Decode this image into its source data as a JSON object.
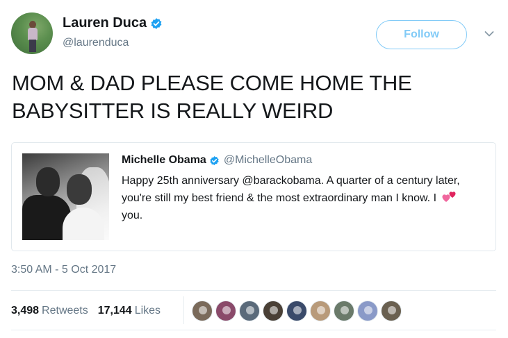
{
  "author": {
    "name": "Lauren Duca",
    "handle": "@laurenduca",
    "verified": true
  },
  "follow_label": "Follow",
  "tweet_text": "MOM & DAD PLEASE COME HOME THE BABYSITTER IS REALLY WEIRD",
  "quoted_tweet": {
    "name": "Michelle Obama",
    "handle": "@MichelleObama",
    "verified": true,
    "text_before_emoji": "Happy 25th anniversary @barackobama. A quarter of a century later, you're still my best friend & the most extraordinary man I know. I",
    "emoji": "two-hearts-emoji",
    "text_after_emoji": "you."
  },
  "timestamp": "3:50 AM - 5 Oct 2017",
  "stats": {
    "retweets_count": "3,498",
    "retweets_label": "Retweets",
    "likes_count": "17,144",
    "likes_label": "Likes"
  },
  "likers": [
    {
      "color": "#7a6a5a"
    },
    {
      "color": "#8a4a6a"
    },
    {
      "color": "#5a6a7a"
    },
    {
      "color": "#4a4036"
    },
    {
      "color": "#3a4a6a"
    },
    {
      "color": "#b89a7a"
    },
    {
      "color": "#6a7a6a"
    },
    {
      "color": "#8a9ac8"
    },
    {
      "color": "#6a6050"
    }
  ],
  "colors": {
    "accent": "#1da1f2",
    "secondary_text": "#657786",
    "primary_text": "#14171a",
    "heart": "#e0245e"
  }
}
